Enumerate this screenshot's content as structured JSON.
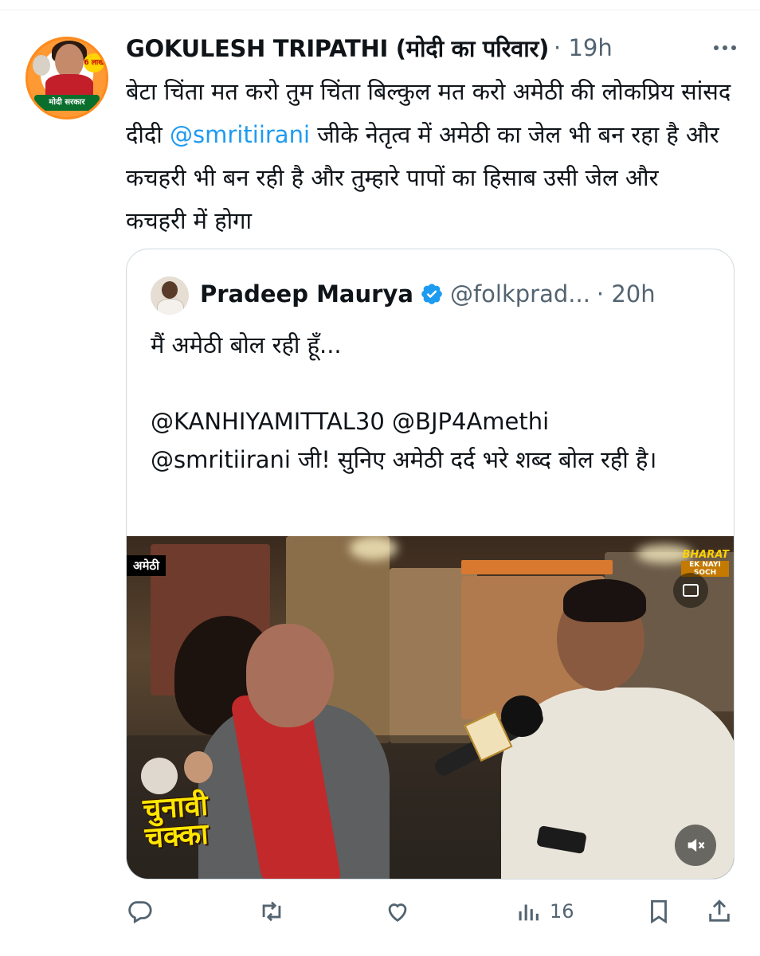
{
  "tweet": {
    "author_name": "GOKULESH TRIPATHI (मोदी का परिवार)",
    "time": "· 19h",
    "body_part1": "बेटा चिंता मत करो तुम चिंता बिल्कुल मत करो अमेठी की लोकप्रिय सांसद दीदी ",
    "mention": "@smritiirani",
    "body_part2": " जीके नेतृत्व में अमेठी का जेल भी बन रहा है और कचहरी भी बन रही है और तुम्हारे पापों का हिसाब उसी जेल और  कचहरी में होगा",
    "avatar_badge": "6 लाख",
    "avatar_ribbon": "मोदी सरकार"
  },
  "quoted": {
    "author_name": "Pradeep Maurya",
    "handle": "@folkprad...",
    "time": "· 20h",
    "line1": "मैं अमेठी बोल रही हूँ...",
    "line2": "@KANHIYAMITTAL30 @BJP4Amethi",
    "line3": "@smritiirani जी! सुनिए अमेठी दर्द भरे शब्द बोल रही है।",
    "video": {
      "corner_tag": "अमेठी",
      "brand_main": "BHARAT",
      "brand_sub": "EK NAYI SOCH",
      "show_logo_line1": "चुनावी",
      "show_logo_line2": "चक्का"
    }
  },
  "actions": {
    "views": "16"
  },
  "colors": {
    "text": "#0f1419",
    "muted": "#536471",
    "link": "#1d9bf0",
    "border": "#cfd9de"
  },
  "icons": [
    "more-icon",
    "verified-badge-icon",
    "closed-captions-icon",
    "mute-icon",
    "reply-icon",
    "retweet-icon",
    "like-icon",
    "views-icon",
    "bookmark-icon",
    "share-icon"
  ]
}
